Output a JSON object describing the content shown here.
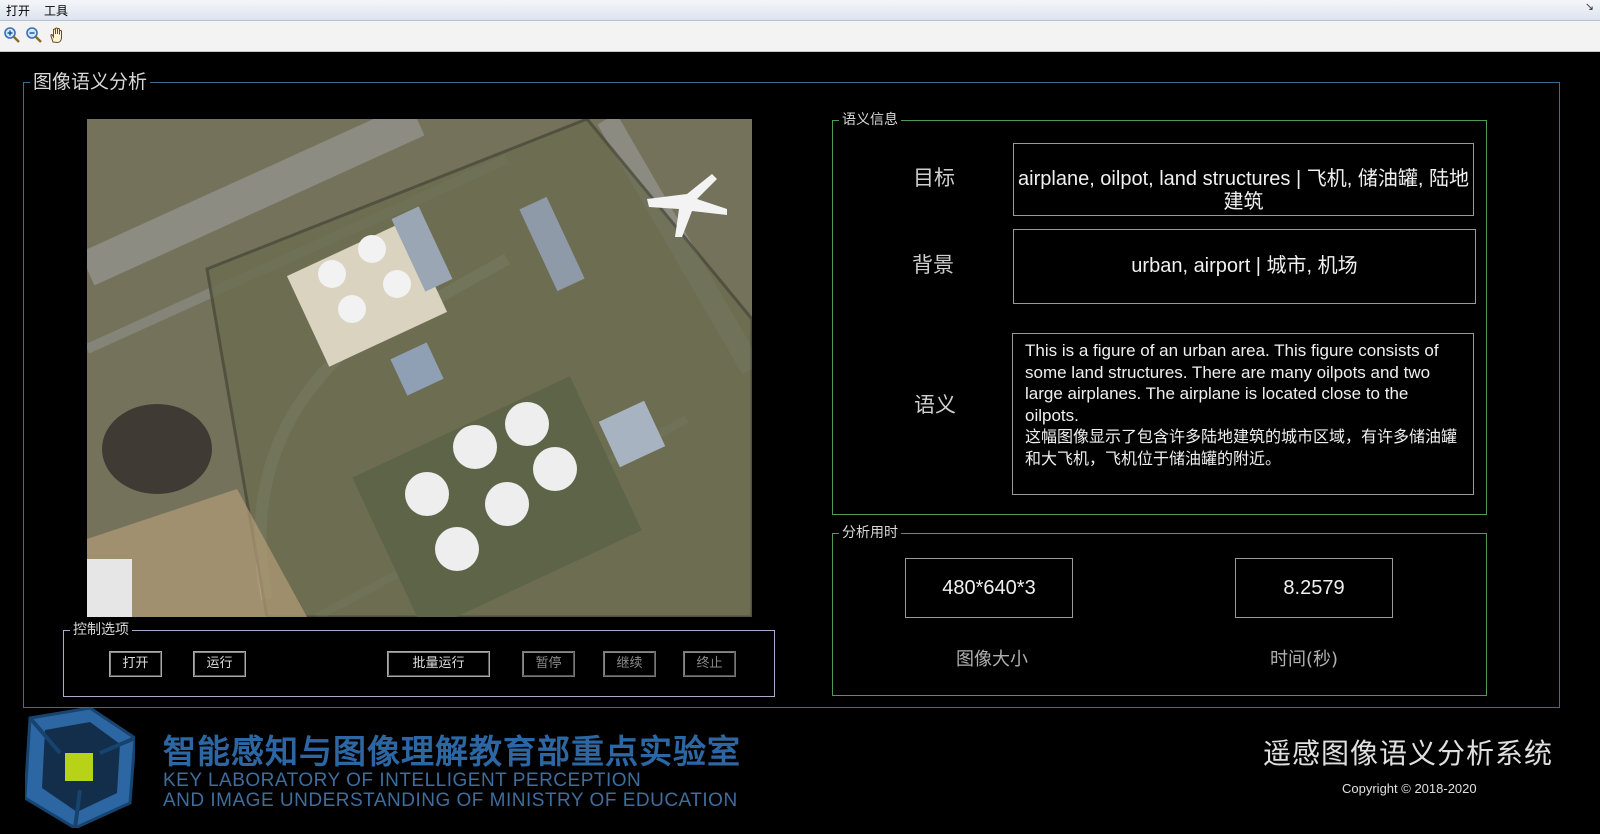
{
  "menu": {
    "items": [
      "打开",
      "工具"
    ],
    "corner_glyph": "↘"
  },
  "toolbar": {
    "icons": [
      "zoom-in-icon",
      "zoom-out-icon",
      "pan-hand-icon"
    ]
  },
  "analysis": {
    "title": "图像语义分析"
  },
  "controls": {
    "title": "控制选项",
    "buttons": [
      {
        "label": "打开",
        "enabled": true
      },
      {
        "label": "运行",
        "enabled": true
      },
      {
        "label": "批量运行",
        "enabled": true
      },
      {
        "label": "暂停",
        "enabled": false
      },
      {
        "label": "继续",
        "enabled": false
      },
      {
        "label": "终止",
        "enabled": false
      }
    ]
  },
  "semantic": {
    "title": "语义信息",
    "target_label": "目标",
    "target_value": "airplane, oilpot, land structures | 飞机, 储油罐, 陆地建筑",
    "background_label": "背景",
    "background_value": "urban, airport | 城市, 机场",
    "semantics_label": "语义",
    "semantics_en": "This is a figure of an urban area. This figure consists of some land structures. There are many oilpots and two large airplanes. The airplane is located close to the oilpots.",
    "semantics_zh": "这幅图像显示了包含许多陆地建筑的城市区域，有许多储油罐和大飞机，飞机位于储油罐的附近。"
  },
  "timing": {
    "title": "分析用时",
    "image_size_value": "480*640*3",
    "image_size_label": "图像大小",
    "time_value": "8.2579",
    "time_label": "时间(秒)"
  },
  "footer": {
    "lab_name_zh": "智能感知与图像理解教育部重点实验室",
    "lab_name_en_line1": "KEY LABORATORY OF INTELLIGENT PERCEPTION",
    "lab_name_en_line2": "AND IMAGE UNDERSTANDING OF MINISTRY OF EDUCATION",
    "system_name": "遥感图像语义分析系统",
    "copyright": "Copyright ©  2018-2020"
  },
  "colors": {
    "frame_blue": "#3d6d92",
    "frame_green": "#4f9a58",
    "frame_purple": "#b7a6cc",
    "logo_blue": "#2c67a4",
    "logo_green": "#b7d318"
  }
}
